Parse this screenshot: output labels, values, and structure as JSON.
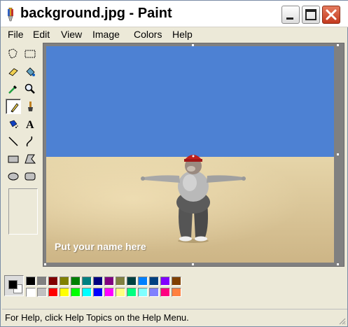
{
  "window": {
    "title": "background.jpg - Paint"
  },
  "menu": {
    "items": [
      "File",
      "Edit",
      "View",
      "Image",
      "Colors",
      "Help"
    ]
  },
  "tools": [
    {
      "name": "free-form-select-icon"
    },
    {
      "name": "select-icon"
    },
    {
      "name": "eraser-icon"
    },
    {
      "name": "fill-icon"
    },
    {
      "name": "pick-color-icon"
    },
    {
      "name": "magnifier-icon"
    },
    {
      "name": "pencil-icon",
      "selected": true
    },
    {
      "name": "brush-icon"
    },
    {
      "name": "airbrush-icon"
    },
    {
      "name": "text-icon",
      "glyph": "A"
    },
    {
      "name": "line-icon"
    },
    {
      "name": "curve-icon"
    },
    {
      "name": "rectangle-icon"
    },
    {
      "name": "polygon-icon"
    },
    {
      "name": "ellipse-icon"
    },
    {
      "name": "rounded-rectangle-icon"
    }
  ],
  "canvas": {
    "caption": "Put your name here",
    "sky_color": "#4d81d3",
    "sand_color": "#dcc89a"
  },
  "palette": {
    "foreground": "#000000",
    "background": "#ffffff",
    "row1": [
      "#000000",
      "#808080",
      "#800000",
      "#808000",
      "#008000",
      "#008080",
      "#000080",
      "#800080",
      "#808040",
      "#004040",
      "#0080ff",
      "#004080",
      "#8000ff",
      "#804000"
    ],
    "row2": [
      "#ffffff",
      "#c0c0c0",
      "#ff0000",
      "#ffff00",
      "#00ff00",
      "#00ffff",
      "#0000ff",
      "#ff00ff",
      "#ffff80",
      "#00ff80",
      "#80ffff",
      "#8080ff",
      "#ff0080",
      "#ff8040"
    ]
  },
  "status": {
    "text": "For Help, click Help Topics on the Help Menu."
  }
}
